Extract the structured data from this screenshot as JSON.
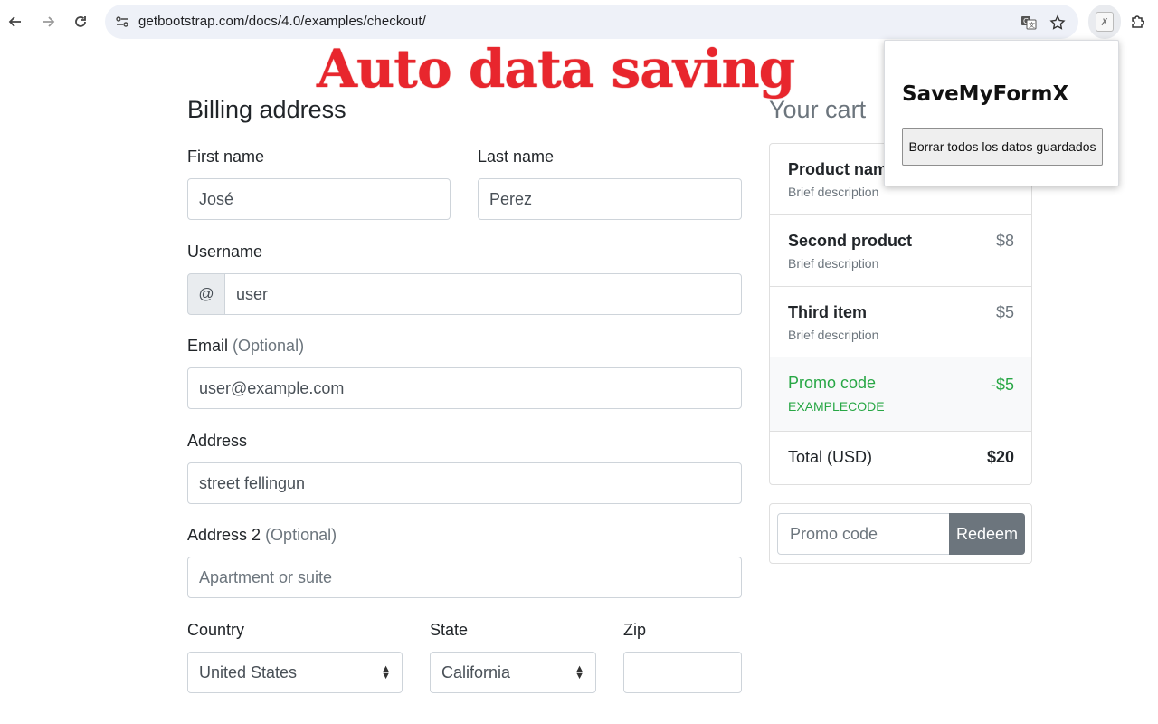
{
  "browser": {
    "url": "getbootstrap.com/docs/4.0/examples/checkout/",
    "icons": {
      "back": "arrow-left-icon",
      "forward": "arrow-right-icon",
      "reload": "reload-icon",
      "site_info": "tune-icon",
      "translate": "translate-icon",
      "bookmark": "star-icon",
      "extension": "savemyformx-extension-icon",
      "extensions_menu": "puzzle-icon"
    }
  },
  "banner": {
    "text": "Auto data saving",
    "color": "#e8262d"
  },
  "form": {
    "title": "Billing address",
    "first_name": {
      "label": "First name",
      "value": "José"
    },
    "last_name": {
      "label": "Last name",
      "value": "Perez"
    },
    "username": {
      "label": "Username",
      "prefix": "@",
      "value": "user"
    },
    "email": {
      "label": "Email",
      "optional": "(Optional)",
      "value": "user@example.com"
    },
    "address": {
      "label": "Address",
      "value": "street fellingun"
    },
    "address2": {
      "label": "Address 2",
      "optional": "(Optional)",
      "placeholder": "Apartment or suite"
    },
    "country": {
      "label": "Country",
      "value": "United States"
    },
    "state": {
      "label": "State",
      "value": "California"
    },
    "zip": {
      "label": "Zip",
      "value": ""
    }
  },
  "cart": {
    "title": "Your cart",
    "items": [
      {
        "name": "Product name",
        "description": "Brief description",
        "price": ""
      },
      {
        "name": "Second product",
        "description": "Brief description",
        "price": "$8"
      },
      {
        "name": "Third item",
        "description": "Brief description",
        "price": "$5"
      }
    ],
    "promo": {
      "name": "Promo code",
      "code": "EXAMPLECODE",
      "price": "-$5"
    },
    "total": {
      "label": "Total (USD)",
      "value": "$20"
    },
    "promo_input": {
      "placeholder": "Promo code",
      "button": "Redeem"
    }
  },
  "popup": {
    "title": "SaveMyFormX",
    "button": "Borrar todos los datos guardados"
  },
  "colors": {
    "promo_green": "#28a745",
    "redeem_gray": "#6c757d"
  }
}
